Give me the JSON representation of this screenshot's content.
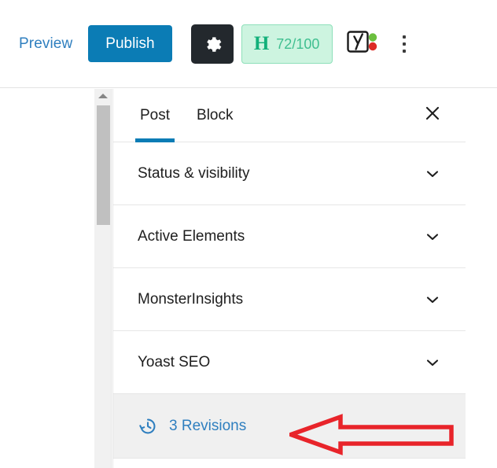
{
  "toolbar": {
    "preview_label": "Preview",
    "publish_label": "Publish",
    "settings_icon": "gear-icon",
    "hemingway": {
      "letter": "H",
      "score": "72/100",
      "bg_color": "#cdf4e0",
      "text_color": "#12b07a"
    },
    "yoast_icon": "yoast-seo-icon",
    "more_menu_icon": "kebab-menu-icon",
    "accent_color": "#0b7cb5"
  },
  "scrollbar": {
    "up_arrow_icon": "triangle-up-icon",
    "thumb_color": "#c0c0c0"
  },
  "panel": {
    "tabs": [
      {
        "label": "Post",
        "active": true
      },
      {
        "label": "Block",
        "active": false
      }
    ],
    "close_icon": "close-icon",
    "sections": [
      {
        "label": "Status & visibility",
        "chevron": "chevron-down-icon"
      },
      {
        "label": "Active Elements",
        "chevron": "chevron-down-icon"
      },
      {
        "label": "MonsterInsights",
        "chevron": "chevron-down-icon"
      },
      {
        "label": "Yoast SEO",
        "chevron": "chevron-down-icon"
      }
    ],
    "revisions": {
      "label": "3 Revisions",
      "icon": "revision-clock-icon",
      "link_color": "#2f7fbf",
      "row_bg": "#f0f0f0"
    }
  },
  "annotation": {
    "arrow_icon": "left-arrow-annotation",
    "color": "#e8242a",
    "direction": "left"
  }
}
